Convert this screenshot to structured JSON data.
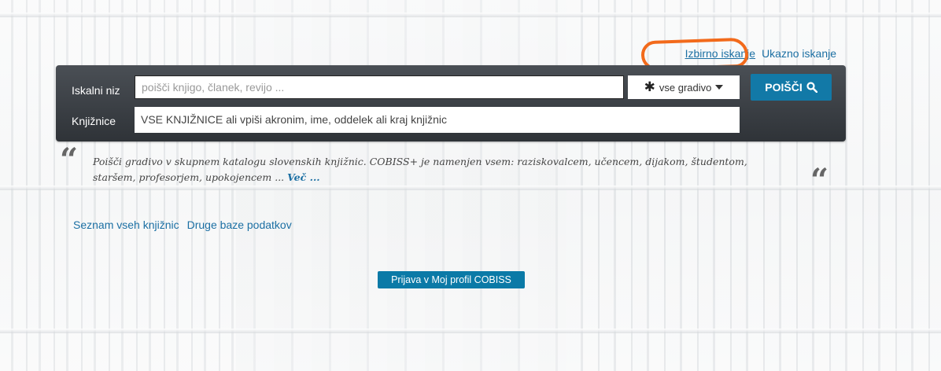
{
  "search_mode": {
    "selective_label": "Izbirno iskanje",
    "command_label": "Ukazno iskanje"
  },
  "search": {
    "query_label": "Iskalni niz",
    "query_placeholder": "poišči knjigo, članek, revijo ...",
    "material_type": "vse gradivo",
    "search_button_label": "POIŠČI",
    "libraries_label": "Knjižnice",
    "libraries_value": "VSE KNJIŽNICE ali vpiši akronim, ime, oddelek ali kraj knjižnic"
  },
  "intro": {
    "text_line1": "Poišči gradivo v skupnem katalogu slovenskih knjižnic. COBISS+ je namenjen vsem: raziskovalcem, učencem, dijakom, študentom,",
    "text_line2": "staršem, profesorjem, upokojencem ...",
    "more_label": "Več ..."
  },
  "links": {
    "all_libraries": "Seznam vseh knjižnic",
    "other_databases": "Druge baze podatkov"
  },
  "login": {
    "button_label": "Prijava v Moj profil COBISS"
  },
  "icons": {
    "asterisk": "asterisk-icon",
    "dropdown": "caret-down-icon",
    "search": "search-icon",
    "quote": "quote-icon"
  },
  "colors": {
    "accent": "#1279a7",
    "link": "#1b6fa3",
    "annotation": "#f26a1b",
    "search_bar": "#3a3e43"
  }
}
